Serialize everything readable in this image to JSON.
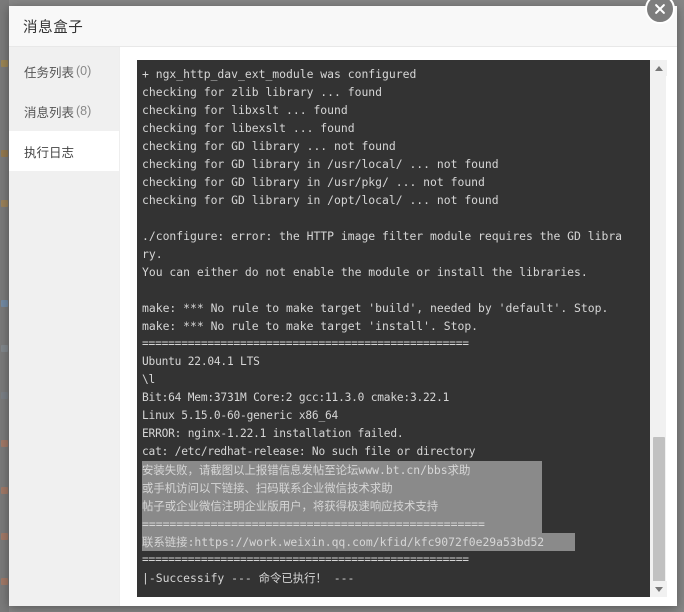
{
  "window": {
    "title": "消息盒子",
    "close_label": "×"
  },
  "sidebar": {
    "items": [
      {
        "label": "任务列表",
        "count": "(0)",
        "active": false
      },
      {
        "label": "消息列表",
        "count": "(8)",
        "active": false
      },
      {
        "label": "执行日志",
        "count": "",
        "active": true
      }
    ]
  },
  "terminal": {
    "background": "#333333",
    "foreground": "#d6d6d6",
    "selection_background": "#8a8a8a",
    "lines": [
      {
        "text": "+ ngx_http_dav_ext_module was configured",
        "selected": false
      },
      {
        "text": "checking for zlib library ... found",
        "selected": false
      },
      {
        "text": "checking for libxslt ... found",
        "selected": false
      },
      {
        "text": "checking for libexslt ... found",
        "selected": false
      },
      {
        "text": "checking for GD library ... not found",
        "selected": false
      },
      {
        "text": "checking for GD library in /usr/local/ ... not found",
        "selected": false
      },
      {
        "text": "checking for GD library in /usr/pkg/ ... not found",
        "selected": false
      },
      {
        "text": "checking for GD library in /opt/local/ ... not found",
        "selected": false
      },
      {
        "text": "",
        "selected": false
      },
      {
        "text": "./configure: error: the HTTP image filter module requires the GD libra",
        "selected": false
      },
      {
        "text": "ry.",
        "selected": false
      },
      {
        "text": "You can either do not enable the module or install the libraries.",
        "selected": false
      },
      {
        "text": "",
        "selected": false
      },
      {
        "text": "make: *** No rule to make target 'build', needed by 'default'. Stop.",
        "selected": false
      },
      {
        "text": "make: *** No rule to make target 'install'. Stop.",
        "selected": false
      },
      {
        "text": "==================================================",
        "selected": false,
        "style": "sys"
      },
      {
        "text": "Ubuntu 22.04.1 LTS",
        "selected": false,
        "style": "sys"
      },
      {
        "text": "\\l",
        "selected": false,
        "style": "sys"
      },
      {
        "text": "Bit:64 Mem:3731M Core:2 gcc:11.3.0 cmake:3.22.1",
        "selected": false,
        "style": "sys"
      },
      {
        "text": "Linux 5.15.0-60-generic x86_64",
        "selected": false,
        "style": "sys"
      },
      {
        "text": "ERROR: nginx-1.22.1 installation failed.",
        "selected": false,
        "style": "sys"
      },
      {
        "text": "cat: /etc/redhat-release: No such file or directory",
        "selected": false,
        "style": "sys"
      },
      {
        "text": "安装失败，请截图以上报错信息发帖至论坛www.bt.cn/bbs求助",
        "selected": true,
        "sel_width": 400
      },
      {
        "text": "或手机访问以下链接、扫码联系企业微信技术求助",
        "selected": true,
        "sel_width": 400
      },
      {
        "text": "帖子或企业微信注明企业版用户，将获得极速响应技术支持",
        "selected": true,
        "sel_width": 400
      },
      {
        "text": "==================================================",
        "selected": true,
        "sel_width": 400
      },
      {
        "text": "联系链接:https://work.weixin.qq.com/kfid/kfc9072f0e29a53bd52",
        "selected": true,
        "sel_width": 433
      },
      {
        "text": "==================================================",
        "selected": false,
        "style": "sys"
      },
      {
        "text": "|-Successify --- 命令已执行！ ---",
        "selected": false
      }
    ]
  },
  "scrollbar": {
    "up_arrow": "scroll-up",
    "down_arrow": "scroll-down",
    "thumb": "scroll-thumb"
  }
}
